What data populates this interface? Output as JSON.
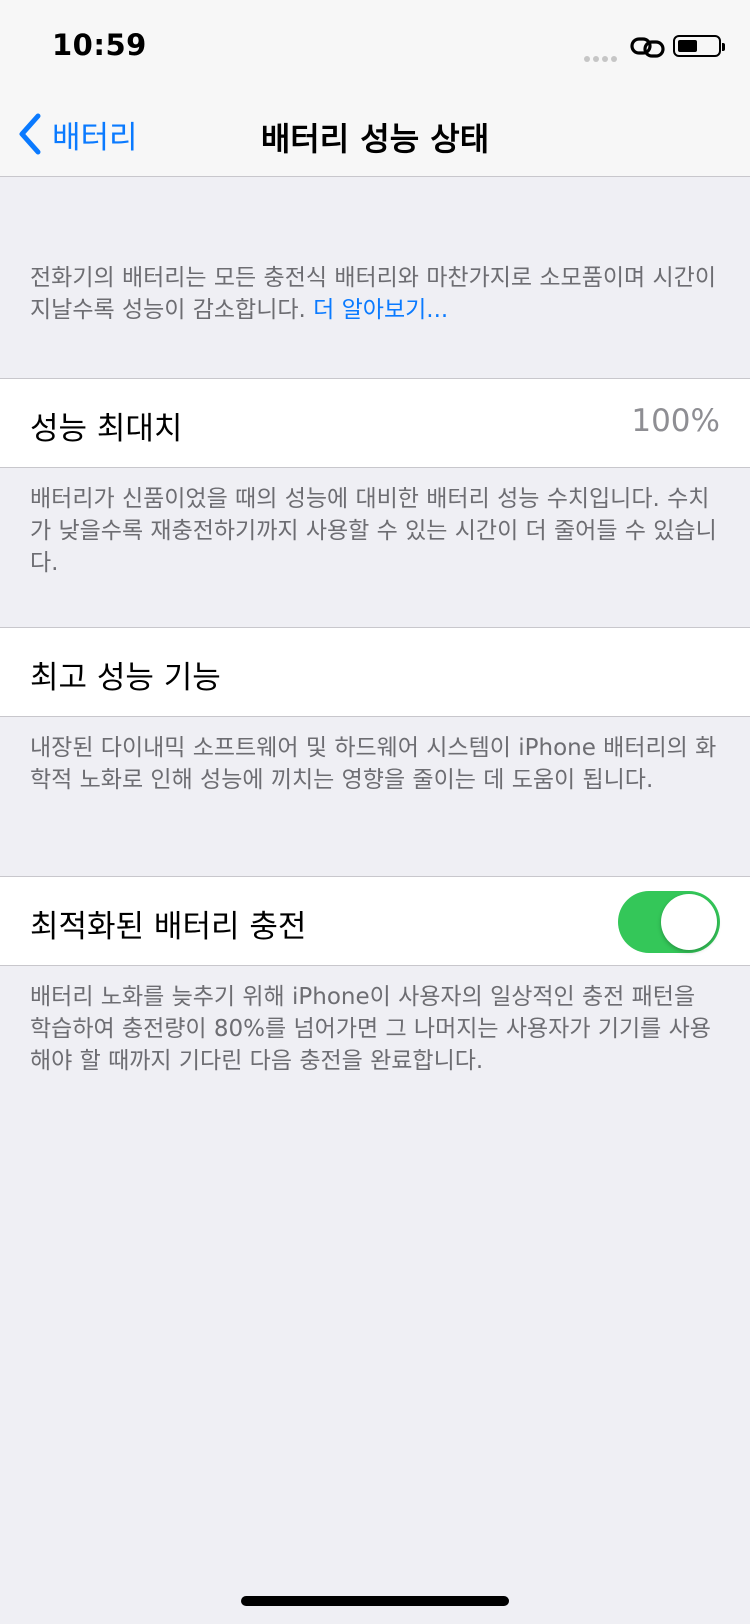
{
  "status_bar": {
    "time": "10:59"
  },
  "nav": {
    "back_label": "배터리",
    "title": "배터리 성능 상태"
  },
  "intro": {
    "text": "전화기의 배터리는 모든 충전식 배터리와 마찬가지로 소모품이며 시간이 지날수록 성능이 감소합니다. ",
    "link": "더 알아보기..."
  },
  "max_capacity": {
    "label": "성능 최대치",
    "value": "100%",
    "footer": "배터리가 신품이었을 때의 성능에 대비한 배터리 성능 수치입니다. 수치가 낮을수록 재충전하기까지 사용할 수 있는 시간이 더 줄어들 수 있습니다."
  },
  "peak_performance": {
    "label": "최고 성능 기능",
    "footer": "내장된 다이내믹 소프트웨어 및 하드웨어 시스템이 iPhone 배터리의 화학적 노화로 인해 성능에 끼치는 영향을 줄이는 데 도움이 됩니다."
  },
  "optimized_charging": {
    "label": "최적화된 배터리 충전",
    "enabled": true,
    "footer": "배터리 노화를 늦추기 위해 iPhone이 사용자의 일상적인 충전 패턴을 학습하여 충전량이 80%를 넘어가면 그 나머지는 사용자가 기기를 사용해야 할 때까지 기다린 다음 충전을 완료합니다."
  },
  "colors": {
    "accent": "#0a7aff",
    "toggle_on": "#34c759",
    "background": "#efeff4"
  },
  "icons": [
    "signal-dots-icon",
    "link-icon",
    "battery-icon",
    "chevron-left-icon"
  ]
}
